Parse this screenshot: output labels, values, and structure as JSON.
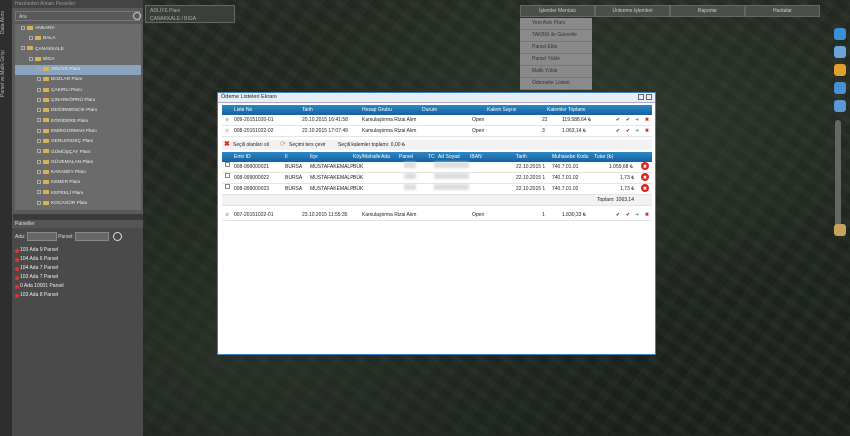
{
  "left_tabs": [
    "Data Alımı",
    "Parsel ve Malik Girişi"
  ],
  "tree": {
    "header": "Hazineden Alınan Parseller",
    "search_placeholder": "Ara",
    "items": [
      "ANKARA",
      "BALA",
      "ÇANAKKALE",
      "BİGA",
      "ADLİYE Planı",
      "BOZLAR Planı",
      "ÇAKIRLI Planı",
      "ÇINARKÖPRÜ Planı",
      "DEĞİRMENCİK Planı",
      "EĞRİDERE Planı",
      "EMİRGORMAN Planı",
      "GERLENGEÇ Planı",
      "GÜMÜŞÇAY Planı",
      "GÜVEMALAN Planı",
      "KARABEY Planı",
      "KEMER Planı",
      "KEPEKLİ Planı",
      "KOCAGÜR Planı"
    ]
  },
  "parcels": {
    "header": "Parseller",
    "ada_label": "Ada:",
    "parsel_label": "Parsel:",
    "items": [
      "103 Ada 9 Parsel",
      "104 Ada 6 Parsel",
      "104 Ada 7 Parsel",
      "103 Ada 7 Parsel",
      "0 Ada 10001 Parsel",
      "103 Ada 8 Parsel"
    ]
  },
  "map_tab": {
    "line1": "ADLİYE Planı",
    "line2": "ÇANAKKALE / BİGA"
  },
  "menu": [
    "İşlemler Menüsü",
    "Ünlenme İşlemleri",
    "Raporlar",
    "Haritalar"
  ],
  "dropdown": [
    "Yeni Askı Planı",
    "TAKBİS ile Güncelle",
    "Parsel Ekle",
    "Parsel Yükle",
    "Malik Yükle",
    "Ödemeler Listesi"
  ],
  "dialog": {
    "title": "Ödeme Listeleri Ekranı",
    "top_headers": [
      "Liste No",
      "Tarih",
      "Hesap Grubu",
      "Durum",
      "Kalem Sayısı",
      "Kalemler Toplamı"
    ],
    "top_rows": [
      {
        "no": "009-20151020-01",
        "date": "20.10.2015 16:41:58",
        "group": "Kamulaştırma Rizai Alım",
        "status": "Open",
        "count": "22",
        "total": "119.588,64 ₺"
      },
      {
        "no": "008-20151022-02",
        "date": "22.10.2015 17:07:49",
        "group": "Kamulaştırma Rizai Alım",
        "status": "Open",
        "count": "3",
        "total": "1.063,14 ₺"
      }
    ],
    "toolbar": {
      "delete": "Seçili olanları sil",
      "invert": "Seçimi ters çevir",
      "sum": "Seçili kalemler toplamı: 0,00 ₺"
    },
    "sub_headers": [
      "Emir ID",
      "İl",
      "İlçe",
      "Köy/Mahalle",
      "Ada",
      "Parsel",
      "TC",
      "Ad Soyad",
      "IBAN",
      "Tarih",
      "Muhasebe Kodu",
      "Tutar (₺)"
    ],
    "sub_rows": [
      {
        "id": "008-999000021",
        "il": "BURSA",
        "ilce": "MUSTAFAKEMALP",
        "koy": "BÜK",
        "date": "22.10.2015 1",
        "code": "740.7.01.01",
        "amount": "1.059,68 ₺"
      },
      {
        "id": "008-999000022",
        "il": "BURSA",
        "ilce": "MUSTAFAKEMALP",
        "koy": "BÜK",
        "date": "22.10.2015 1",
        "code": "740.7.01.02",
        "amount": "1,73 ₺"
      },
      {
        "id": "008-999000023",
        "il": "BURSA",
        "ilce": "MUSTAFAKEMALP",
        "koy": "BÜK",
        "date": "22.10.2015 1",
        "code": "740.7.01.02",
        "amount": "1,73 ₺"
      }
    ],
    "sub_total": "Toplam: 1063,14",
    "bottom_row": {
      "no": "007-20151022-01",
      "date": "23.10.2015 11:55:35",
      "group": "Kamulaştırma Rizai Alım",
      "status": "Open",
      "count": "1",
      "total": "1.830,33 ₺"
    }
  },
  "colors": {
    "header_blue": "#1f72b3",
    "delete_red": "#d9241c",
    "approve_green": "#3aa63a"
  }
}
